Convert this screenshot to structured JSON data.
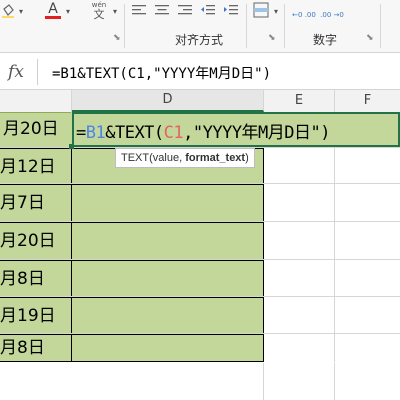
{
  "ribbon": {
    "font_group_label": "",
    "align_group_label": "对齐方式",
    "number_group_label": "数字",
    "partial_label": "",
    "font_color_letter": "A",
    "wen_label": "wén",
    "wen_char": "文",
    "num_icon_text": "←0 .00",
    "num_icon_text2": ".00 →0",
    "icons": [
      "paint-bucket-icon",
      "font-color-icon",
      "phonetic-guide-icon",
      "align-left-icon",
      "align-center-icon",
      "align-right-icon",
      "indent-decrease-icon",
      "indent-increase-icon",
      "wrap-merge-icon",
      "increase-decimal-icon",
      "decrease-decimal-icon"
    ]
  },
  "formula_bar": {
    "fx_label": "fx",
    "formula": "=B1&TEXT(C1,\"YYYY年M月D日\")"
  },
  "columns": {
    "C": "",
    "D": "D",
    "E": "E",
    "F": "F"
  },
  "rows": [
    {
      "c": "月20日"
    },
    {
      "c": "月12日"
    },
    {
      "c": "月7日"
    },
    {
      "c": "月20日"
    },
    {
      "c": "月8日"
    },
    {
      "c": "月19日"
    },
    {
      "c": "月8日"
    }
  ],
  "edit_cell": {
    "eq": "=",
    "ref1": "B1",
    "mid": "&TEXT(",
    "ref2": "C1",
    "rest": ",\"YYYY年M月D日\")"
  },
  "tooltip": {
    "fn": "TEXT(value, ",
    "arg": "format_text",
    "end": ")"
  },
  "colors": {
    "cell_green": "#c4d79b",
    "active_border": "#217346",
    "ref_b1": "#4a86e8",
    "ref_c1": "#e06666"
  }
}
